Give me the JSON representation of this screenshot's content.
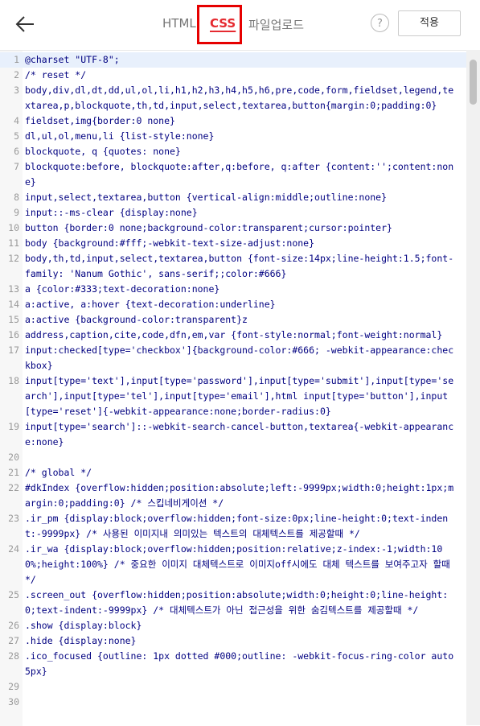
{
  "header": {
    "tabs": [
      "HTML",
      "CSS",
      "파일업로드"
    ],
    "help_label": "?",
    "apply_label": "적용"
  },
  "editor": {
    "lines": [
      {
        "n": "1",
        "t": "@charset \"UTF-8\";"
      },
      {
        "n": "2",
        "t": "/* reset */"
      },
      {
        "n": "3",
        "t": "body,div,dl,dt,dd,ul,ol,li,h1,h2,h3,h4,h5,h6,pre,code,form,fieldset,legend,textarea,p,blockquote,th,td,input,select,textarea,button{margin:0;padding:0}"
      },
      {
        "n": "4",
        "t": "fieldset,img{border:0 none}"
      },
      {
        "n": "5",
        "t": "dl,ul,ol,menu,li {list-style:none}"
      },
      {
        "n": "6",
        "t": "blockquote, q {quotes: none}"
      },
      {
        "n": "7",
        "t": "blockquote:before, blockquote:after,q:before, q:after {content:'';content:none}"
      },
      {
        "n": "8",
        "t": "input,select,textarea,button {vertical-align:middle;outline:none}"
      },
      {
        "n": "9",
        "t": "input::-ms-clear {display:none}"
      },
      {
        "n": "10",
        "t": "button {border:0 none;background-color:transparent;cursor:pointer}"
      },
      {
        "n": "11",
        "t": "body {background:#fff;-webkit-text-size-adjust:none}"
      },
      {
        "n": "12",
        "t": "body,th,td,input,select,textarea,button {font-size:14px;line-height:1.5;font-family: 'Nanum Gothic', sans-serif;;color:#666}"
      },
      {
        "n": "13",
        "t": "a {color:#333;text-decoration:none}"
      },
      {
        "n": "14",
        "t": "a:active, a:hover {text-decoration:underline}"
      },
      {
        "n": "15",
        "t": "a:active {background-color:transparent}z"
      },
      {
        "n": "16",
        "t": "address,caption,cite,code,dfn,em,var {font-style:normal;font-weight:normal}"
      },
      {
        "n": "17",
        "t": "input:checked[type='checkbox']{background-color:#666; -webkit-appearance:checkbox}"
      },
      {
        "n": "18",
        "t": "input[type='text'],input[type='password'],input[type='submit'],input[type='search'],input[type='tel'],input[type='email'],html input[type='button'],input[type='reset']{-webkit-appearance:none;border-radius:0}"
      },
      {
        "n": "19",
        "t": "input[type='search']::-webkit-search-cancel-button,textarea{-webkit-appearance:none}"
      },
      {
        "n": "20",
        "t": ""
      },
      {
        "n": "21",
        "t": "/* global */"
      },
      {
        "n": "22",
        "t": "#dkIndex {overflow:hidden;position:absolute;left:-9999px;width:0;height:1px;margin:0;padding:0} /* 스킵네비게이션 */"
      },
      {
        "n": "23",
        "t": ".ir_pm {display:block;overflow:hidden;font-size:0px;line-height:0;text-indent:-9999px} /* 사용된 이미지내 의미있는 텍스트의 대체텍스트를 제공할때 */"
      },
      {
        "n": "24",
        "t": ".ir_wa {display:block;overflow:hidden;position:relative;z-index:-1;width:100%;height:100%} /* 중요한 이미지 대체텍스트로 이미지off시에도 대체 텍스트를 보여주고자 할때 */"
      },
      {
        "n": "25",
        "t": ".screen_out {overflow:hidden;position:absolute;width:0;height:0;line-height:0;text-indent:-9999px} /* 대체텍스트가 아닌 접근성을 위한 숨김텍스트를 제공할때 */"
      },
      {
        "n": "26",
        "t": ".show {display:block}"
      },
      {
        "n": "27",
        "t": ".hide {display:none}"
      },
      {
        "n": "28",
        "t": ".ico_focused {outline: 1px dotted #000;outline: -webkit-focus-ring-color auto 5px}"
      },
      {
        "n": "29",
        "t": ""
      },
      {
        "n": "30",
        "t": ""
      }
    ]
  }
}
